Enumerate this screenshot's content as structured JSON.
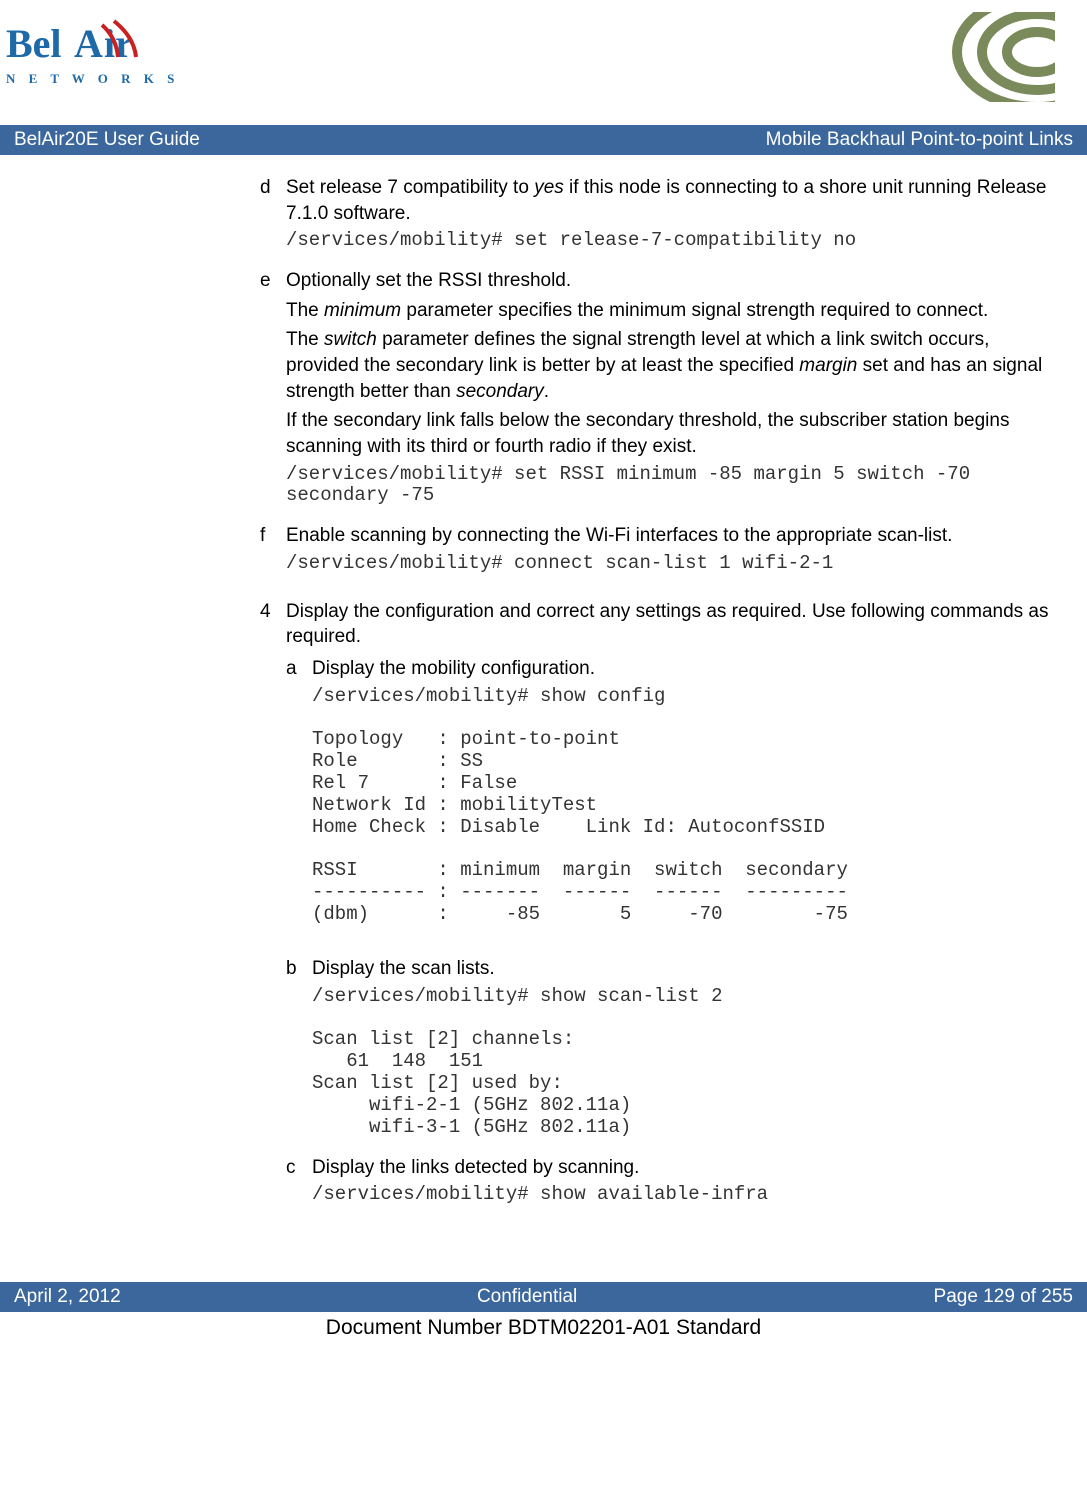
{
  "logo": {
    "line1": "BelAir",
    "line2": "N E T W O R K S"
  },
  "titlebar": {
    "left": "BelAir20E User Guide",
    "right": "Mobile Backhaul Point-to-point Links"
  },
  "items": {
    "d": {
      "marker": "d",
      "text_pre": "Set release 7 compatibility to ",
      "text_em": "yes",
      "text_post": " if this node is connecting to a shore unit running Release 7.1.0 software.",
      "code": "/services/mobility# set release-7-compatibility no"
    },
    "e": {
      "marker": "e",
      "text": "Optionally set the RSSI threshold.",
      "p1_pre": "The ",
      "p1_em": "minimum",
      "p1_post": " parameter specifies the minimum signal strength required to connect.",
      "p2_pre": "The ",
      "p2_em1": "switch",
      "p2_mid": " parameter defines the signal strength level at which a link switch occurs, provided the secondary link is better by at least the specified ",
      "p2_em2": "margin",
      "p2_mid2": " set and has an signal strength better than ",
      "p2_em3": "secondary",
      "p2_post": ".",
      "p3": "If the secondary link falls below the secondary threshold, the subscriber station begins scanning with its third or fourth radio if they exist.",
      "code": "/services/mobility# set RSSI minimum -85 margin 5 switch -70\nsecondary -75"
    },
    "f": {
      "marker": "f",
      "text": "Enable scanning by connecting the Wi-Fi interfaces to the appropriate scan-list.",
      "code": "/services/mobility# connect scan-list 1 wifi-2-1"
    }
  },
  "step4": {
    "marker": "4",
    "text": "Display the configuration and correct any settings as required. Use following commands as required."
  },
  "sub": {
    "a": {
      "marker": "a",
      "text": "Display the mobility configuration.",
      "code": "/services/mobility# show config\n\nTopology   : point-to-point\nRole       : SS\nRel 7      : False\nNetwork Id : mobilityTest\nHome Check : Disable    Link Id: AutoconfSSID\n\nRSSI       : minimum  margin  switch  secondary\n---------- : -------  ------  ------  ---------\n(dbm)      :     -85       5     -70        -75"
    },
    "b": {
      "marker": "b",
      "text": "Display the scan lists.",
      "code": "/services/mobility# show scan-list 2\n\nScan list [2] channels:\n   61  148  151\nScan list [2] used by:\n     wifi-2-1 (5GHz 802.11a)\n     wifi-3-1 (5GHz 802.11a)"
    },
    "c": {
      "marker": "c",
      "text": "Display the links detected by scanning.",
      "code": "/services/mobility# show available-infra"
    }
  },
  "footer": {
    "left": "April 2, 2012",
    "center": "Confidential",
    "right": "Page 129 of 255"
  },
  "docnum": "Document Number BDTM02201-A01 Standard"
}
